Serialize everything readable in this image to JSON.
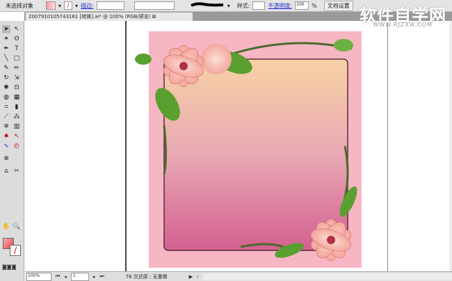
{
  "control_bar": {
    "selection": "未选择对象",
    "stroke_label": "描边:",
    "style_label": "样式:",
    "opacity_label": "不透明度:",
    "opacity_value": "100",
    "percent": "%",
    "doc_setup": "文档设置"
  },
  "document_tab": {
    "title": "2007910105743161 [转换].ai* @ 100% (RGB/预览)"
  },
  "status_bar": {
    "zoom": "100%",
    "artboard": "1",
    "info": "78 次还原 ; 无重做"
  },
  "watermark": {
    "title": "软件自学网",
    "url": "WWW.RJZXW.COM"
  },
  "colors": {
    "frame_pink": "#f7b6c4",
    "gradient_top": "#f8d2a4",
    "gradient_bottom": "#d46090"
  }
}
